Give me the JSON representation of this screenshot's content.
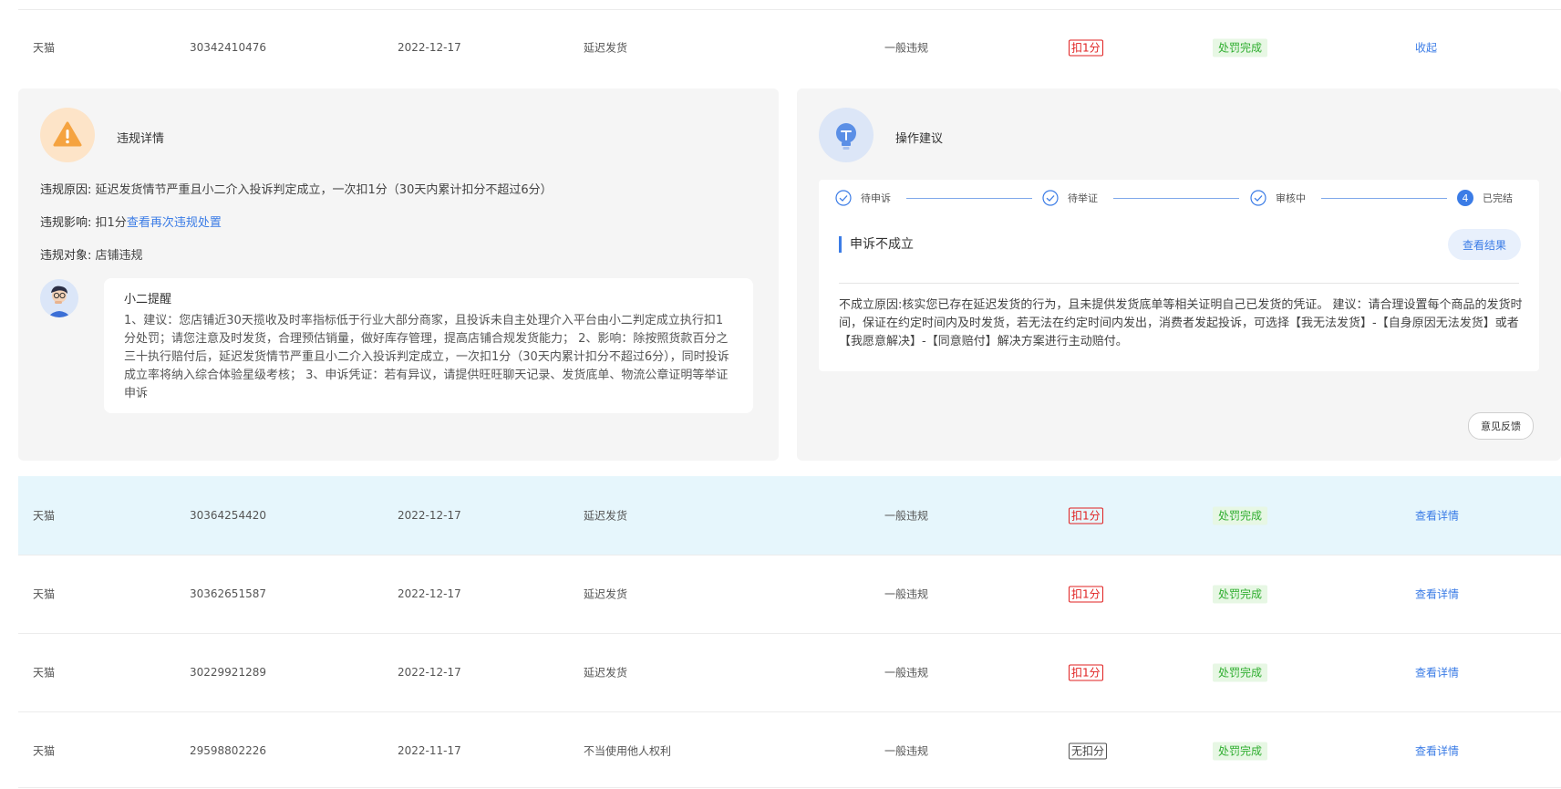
{
  "top_row": {
    "platform": "天猫",
    "id": "30342410476",
    "date": "2022-12-17",
    "type": "延迟发货",
    "level": "一般违规",
    "penalty": "扣1分",
    "status": "处罚完成",
    "action": "收起"
  },
  "details": {
    "title": "违规详情",
    "reason_label": "违规原因:",
    "reason_value": "延迟发货情节严重且小二介入投诉判定成立，一次扣1分（30天内累计扣分不超过6分）",
    "impact_label": "违规影响:",
    "impact_value": "扣1分",
    "impact_link": "查看再次违规处置",
    "object_label": "违规对象:",
    "object_value": "店铺违规",
    "tip_title": "小二提醒",
    "tip_text": "1、建议：您店铺近30天揽收及时率指标低于行业大部分商家，且投诉未自主处理介入平台由小二判定成立执行扣1分处罚；请您注意及时发货，合理预估销量，做好库存管理，提高店铺合规发货能力； 2、影响：除按照货款百分之三十执行赔付后，延迟发货情节严重且小二介入投诉判定成立，一次扣1分（30天内累计扣分不超过6分），同时投诉成立率将纳入综合体验星级考核； 3、申诉凭证：若有异议，请提供旺旺聊天记录、发货底单、物流公章证明等举证申诉"
  },
  "advice": {
    "title": "操作建议",
    "steps": [
      {
        "label": "待申诉"
      },
      {
        "label": "待举证"
      },
      {
        "label": "审核中"
      },
      {
        "label": "已完结",
        "number": "4"
      }
    ],
    "result_title": "申诉不成立",
    "result_button": "查看结果",
    "reason_label": "不成立原因:",
    "reason_text": "核实您已存在延迟发货的行为，且未提供发货底单等相关证明自己已发货的凭证。 建议：请合理设置每个商品的发货时间，保证在约定时间内及时发货，若无法在约定时间内发出，消费者发起投诉，可选择【我无法发货】-【自身原因无法发货】或者【我愿意解决】-【同意赔付】解决方案进行主动赔付。",
    "feedback": "意见反馈"
  },
  "rows": [
    {
      "platform": "天猫",
      "id": "30364254420",
      "date": "2022-12-17",
      "type": "延迟发货",
      "level": "一般违规",
      "penalty": "扣1分",
      "status": "处罚完成",
      "action": "查看详情"
    },
    {
      "platform": "天猫",
      "id": "30362651587",
      "date": "2022-12-17",
      "type": "延迟发货",
      "level": "一般违规",
      "penalty": "扣1分",
      "status": "处罚完成",
      "action": "查看详情"
    },
    {
      "platform": "天猫",
      "id": "30229921289",
      "date": "2022-12-17",
      "type": "延迟发货",
      "level": "一般违规",
      "penalty": "扣1分",
      "status": "处罚完成",
      "action": "查看详情"
    },
    {
      "platform": "天猫",
      "id": "29598802226",
      "date": "2022-11-17",
      "type": "不当使用他人权利",
      "level": "一般违规",
      "penalty": "无扣分",
      "status": "处罚完成",
      "action": "查看详情"
    }
  ],
  "colors": {
    "accent": "#3b7ce6",
    "penalty_red": "#e02020",
    "status_green": "#2fae2f",
    "highlight_row": "#e6f6fc"
  }
}
